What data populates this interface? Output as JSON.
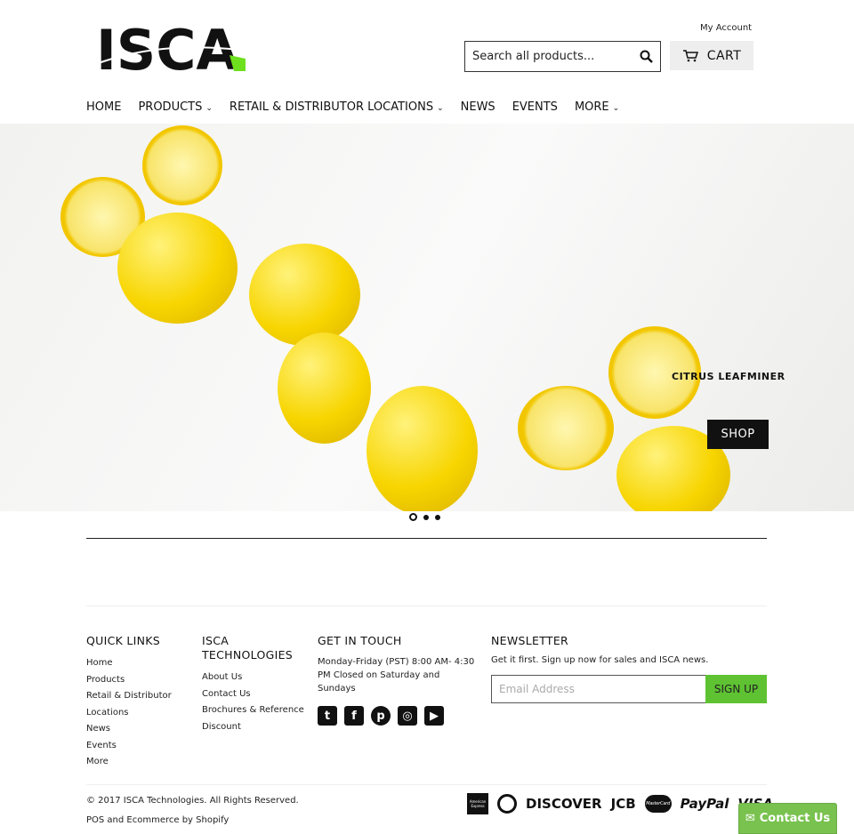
{
  "header": {
    "logo_text": "ISCA",
    "my_account": "My Account",
    "search_placeholder": "Search all products...",
    "cart_label": "CART"
  },
  "nav": [
    {
      "label": "HOME",
      "dropdown": false
    },
    {
      "label": "PRODUCTS",
      "dropdown": true
    },
    {
      "label": "RETAIL & DISTRIBUTOR LOCATIONS",
      "dropdown": true
    },
    {
      "label": "NEWS",
      "dropdown": false
    },
    {
      "label": "EVENTS",
      "dropdown": false
    },
    {
      "label": "MORE",
      "dropdown": true
    }
  ],
  "hero": {
    "caption": "CITRUS LEAFMINER",
    "button": "SHOP",
    "slide_count": 3,
    "active_slide": 1
  },
  "footer": {
    "quick_links": {
      "title": "QUICK LINKS",
      "items": [
        "Home",
        "Products",
        "Retail & Distributor Locations",
        "News",
        "Events",
        "More"
      ]
    },
    "company": {
      "title": "ISCA TECHNOLOGIES",
      "items": [
        "About Us",
        "Contact Us",
        "Brochures & Reference",
        "Discount"
      ]
    },
    "touch": {
      "title": "GET IN TOUCH",
      "hours": "Monday-Friday (PST) 8:00 AM- 4:30 PM Closed on Saturday and Sundays",
      "social": [
        "twitter-icon",
        "facebook-icon",
        "pinterest-icon",
        "instagram-icon",
        "youtube-icon"
      ]
    },
    "newsletter": {
      "title": "NEWSLETTER",
      "text": "Get it first. Sign up now for sales and ISCA news.",
      "placeholder": "Email Address",
      "button": "SIGN UP"
    },
    "copyright": "© 2017 ISCA Technologies. All Rights Reserved.",
    "powered": "POS and Ecommerce by Shopify",
    "payments": [
      "American Express",
      "Diners",
      "DISCOVER",
      "JCB",
      "MasterCard",
      "PayPal",
      "VISA"
    ]
  },
  "contact_widget": "Contact Us",
  "colors": {
    "accent_green": "#5ec232",
    "contact_green": "#79c24f"
  }
}
